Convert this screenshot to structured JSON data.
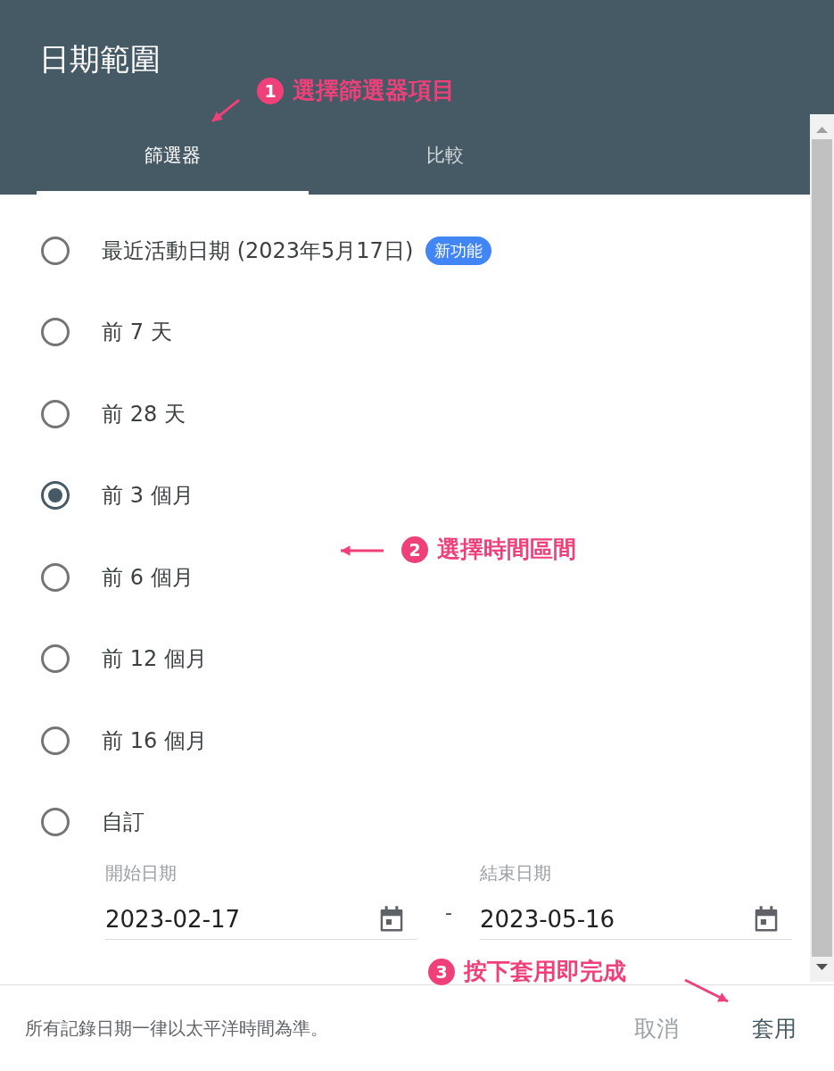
{
  "dialog": {
    "title": "日期範圍"
  },
  "tabs": [
    {
      "label": "篩選器",
      "selected": true
    },
    {
      "label": "比較",
      "selected": false
    }
  ],
  "options": [
    {
      "label": "最近活動日期 (2023年5月17日)",
      "badge": "新功能",
      "selected": false
    },
    {
      "label": "前 7 天",
      "selected": false
    },
    {
      "label": "前 28 天",
      "selected": false
    },
    {
      "label": "前 3 個月",
      "selected": true
    },
    {
      "label": "前 6 個月",
      "selected": false
    },
    {
      "label": "前 12 個月",
      "selected": false
    },
    {
      "label": "前 16 個月",
      "selected": false
    },
    {
      "label": "自訂",
      "selected": false
    }
  ],
  "custom_range": {
    "start": {
      "label": "開始日期",
      "value": "2023-02-17"
    },
    "separator": "-",
    "end": {
      "label": "結束日期",
      "value": "2023-05-16"
    }
  },
  "footer": {
    "note": "所有記錄日期一律以太平洋時間為準。",
    "buttons": [
      {
        "label": "取消",
        "kind": "secondary"
      },
      {
        "label": "套用",
        "kind": "primary"
      }
    ]
  },
  "annotations": [
    {
      "number": "1",
      "text": "選擇篩選器項目"
    },
    {
      "number": "2",
      "text": "選擇時間區間"
    },
    {
      "number": "3",
      "text": "按下套用即完成"
    }
  ]
}
